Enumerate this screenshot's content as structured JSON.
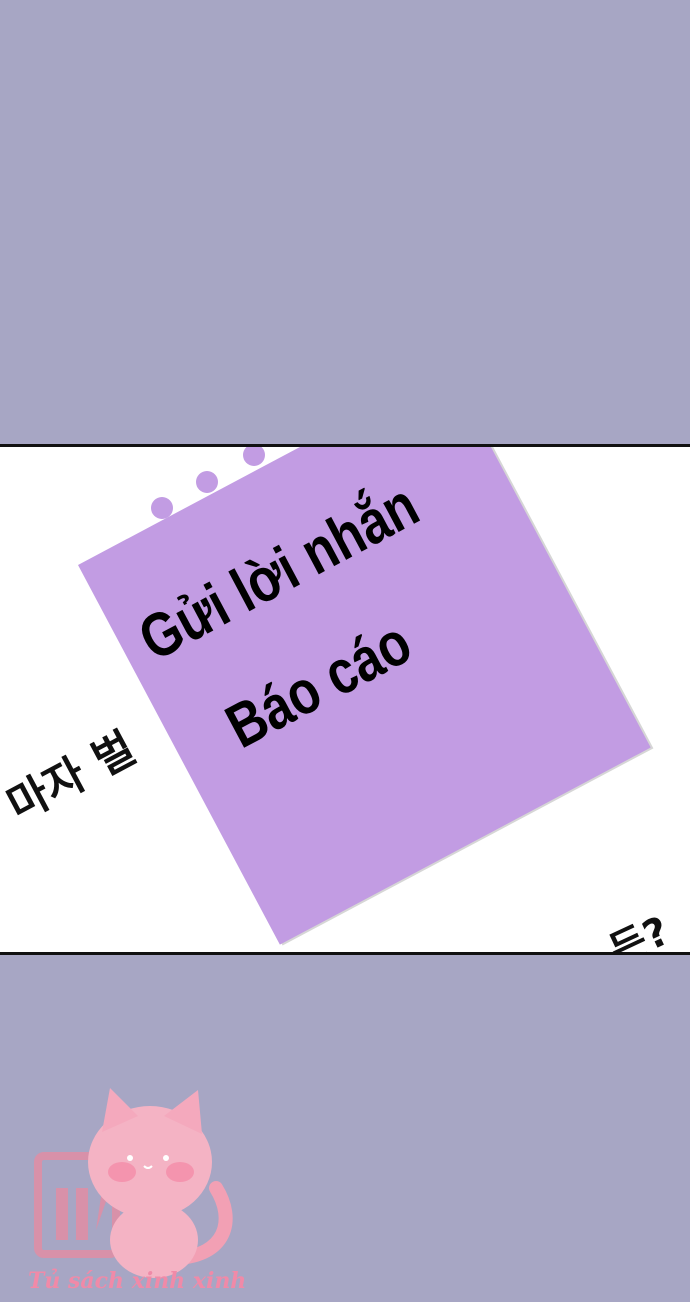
{
  "message_menu": {
    "send_message_label": "Gửi lời nhắn",
    "report_label": "Báo cáo"
  },
  "background_text": {
    "korean_left": "마자 벌",
    "korean_right": "든?"
  },
  "watermark": {
    "text": "Tủ sách xinh xinh"
  },
  "colors": {
    "background": "#a7a6c4",
    "card": "#c29ce3",
    "watermark": "#f08aa8"
  }
}
